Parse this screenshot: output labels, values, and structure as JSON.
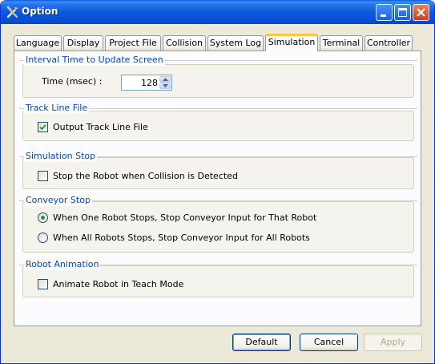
{
  "window": {
    "title": "Option",
    "icon": "tools-icon",
    "controls": [
      "minimize-icon",
      "maximize-icon",
      "close-icon"
    ]
  },
  "tabs": [
    {
      "label": "Language"
    },
    {
      "label": "Display"
    },
    {
      "label": "Project File"
    },
    {
      "label": "Collision"
    },
    {
      "label": "System Log"
    },
    {
      "label": "Simulation",
      "active": true
    },
    {
      "label": "Terminal"
    },
    {
      "label": "Controller"
    }
  ],
  "interval": {
    "title": "Interval Time to Update Screen",
    "time_label": "Time (msec) :",
    "time_value": "128"
  },
  "track": {
    "title": "Track Line File",
    "output_label": "Output Track Line File",
    "output_checked": true
  },
  "sim_stop": {
    "title": "Simulation Stop",
    "stop_label": "Stop the Robot when Collision is Detected",
    "stop_checked": false
  },
  "conveyor": {
    "title": "Conveyor Stop",
    "option_one": "When One Robot Stops, Stop Conveyor Input for That Robot",
    "option_all": "When All Robots Stops, Stop Conveyor Input for All Robots",
    "selected": "option_one"
  },
  "animation": {
    "title": "Robot Animation",
    "animate_label": "Animate Robot in Teach Mode",
    "animate_checked": false
  },
  "buttons": {
    "default": "Default",
    "cancel": "Cancel",
    "apply": "Apply"
  },
  "colors": {
    "titlebar": "#0a58de",
    "group_title": "#0046d5",
    "active_tab_highlight": "#ffc83c",
    "dialog_background": "#ece9d8"
  }
}
